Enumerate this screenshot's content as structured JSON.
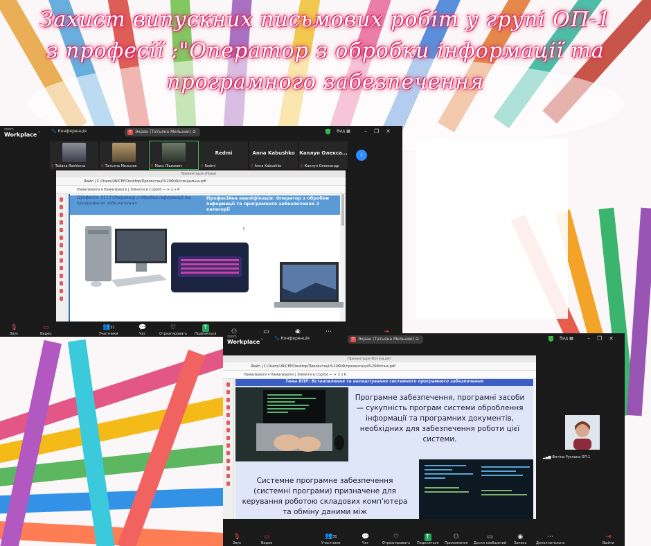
{
  "colors": {
    "title_glow": "#e0245e",
    "zoom_bg": "#1a1a1a",
    "slide_band": "#5b9bd5",
    "accent_blue": "#2d8cff",
    "share_green": "#22a55b"
  },
  "title": {
    "line1": "Захист  випускних  письмових робіт у групі ОП-1",
    "line2": "з професії :\"Оператор з обробки інформації та",
    "line3": "програмного забезпечення"
  },
  "zoom1": {
    "logo_small": "zoom",
    "logo_big": "Workplace",
    "conference": "Конференція",
    "screen_label": "Экран (Татьяна Мельник)",
    "view_label": "Вид",
    "participants": [
      {
        "name": "Tatiana Rozhkova",
        "icon": "video-tile-photo"
      },
      {
        "name": "Татьяна Мельник",
        "icon": "video-tile-photo"
      },
      {
        "name": "Макс Лішкевич",
        "icon": "video-tile-photo"
      },
      {
        "name": "Redmi",
        "big": "Redmi"
      },
      {
        "name": "Anna Kabushko",
        "big": "Anna Kabushko"
      },
      {
        "name": "Каплун Олександр",
        "big": "Каплун Олекса..."
      }
    ],
    "browser": {
      "title": "Презентація (Нова)",
      "address": "Файл   |   C:/Users/UNICEF/Desktop/Презентації%20Ф/Ф/спеціальна.pdf",
      "toolbar": "Намалювати   ▾   Намалювати   |   Змінити в Copilot   —   +   2  з 4"
    },
    "slide": {
      "left_text": "Професія: 4113 Оператор з обробки інформації та програмного забезпечення",
      "right_text": "Професійна кваліфікація: Оператор з обробки інформації та програмного забезпечення 2 категорії",
      "cursor": "I"
    },
    "controls": [
      {
        "label": "Звук",
        "icon": "mic-muted-icon"
      },
      {
        "label": "Видео",
        "icon": "video-off-icon"
      },
      {
        "label": "Участники",
        "icon": "participants-icon",
        "count": "31"
      },
      {
        "label": "Чат",
        "icon": "chat-icon"
      },
      {
        "label": "Отреагировать",
        "icon": "react-icon"
      },
      {
        "label": "Поделиться",
        "icon": "share-icon"
      },
      {
        "label": "",
        "icon": "apps-icon"
      },
      {
        "label": "",
        "icon": "whiteboard-icon"
      },
      {
        "label": "",
        "icon": "record-icon"
      },
      {
        "label": "",
        "icon": "more-icon"
      },
      {
        "label": "",
        "icon": "leave-icon"
      }
    ]
  },
  "zoom2": {
    "logo_small": "zoom",
    "logo_big": "Workplace",
    "conference": "Конференція",
    "screen_label": "Экран (Татьяна Мельник)",
    "view_label": "Вид",
    "browser": {
      "title": "Презентація Фотіна.pdf",
      "address": "Файл   |   C:/Users/UNICEF/Desktop/Презентації%20Ф/Ф/презентація%20Фотіна.pdf",
      "toolbar": "Намалювати   ▾   Намалювати   |   Змінити в Copilot   —   +   3  з 6"
    },
    "slide": {
      "top_banner": "Тема ВПР: Встановлення та налаштування системного програмного забезпечення",
      "text1": "Програмне забезпечення, програмні засоби  — сукупність програм системи оброблення інформації та програмних документів, необхідних для забезпечення роботи цієї системи.",
      "text2": "Системне програмне забезпечення (системні програми) призначене для керування роботою складових комп'ютера та обміну даними між"
    },
    "participant": {
      "name": "Фотіна Руслана ОП-1"
    },
    "controls": [
      {
        "label": "Звук",
        "icon": "mic-muted-icon"
      },
      {
        "label": "Видео",
        "icon": "video-off-icon"
      },
      {
        "label": "Участники",
        "icon": "participants-icon",
        "count": "31"
      },
      {
        "label": "Чат",
        "icon": "chat-icon"
      },
      {
        "label": "Отреагировать",
        "icon": "react-icon"
      },
      {
        "label": "Поделиться",
        "icon": "share-icon"
      },
      {
        "label": "Приложения",
        "icon": "apps-icon"
      },
      {
        "label": "Доски сообщений",
        "icon": "whiteboard-icon"
      },
      {
        "label": "Запись",
        "icon": "record-icon"
      },
      {
        "label": "Дополнительно",
        "icon": "more-icon"
      },
      {
        "label": "Выйти",
        "icon": "leave-icon"
      }
    ]
  }
}
